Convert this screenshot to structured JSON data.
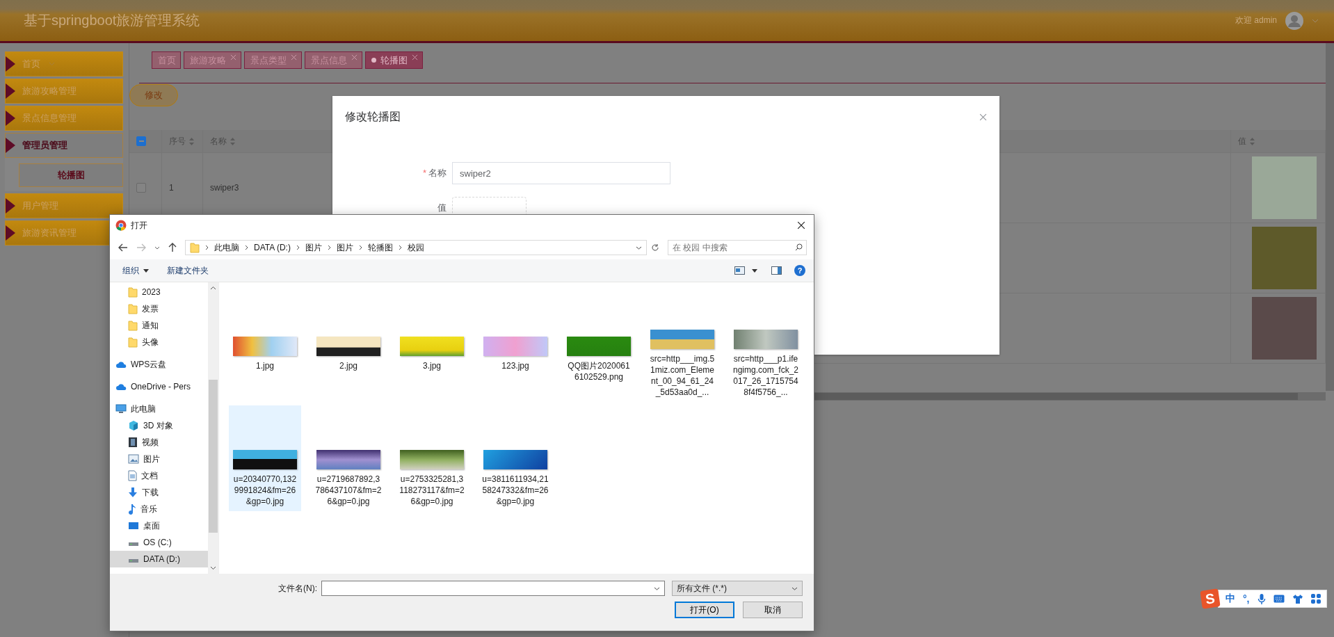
{
  "header": {
    "title": "基于springboot旅游管理系统",
    "greeting": "欢迎 admin"
  },
  "sidebar": {
    "items": [
      {
        "label": "首页",
        "kind": "dropdown",
        "expanded": false
      },
      {
        "label": "旅游攻略管理",
        "kind": "menu",
        "expanded": false
      },
      {
        "label": "景点信息管理",
        "kind": "menu",
        "expanded": false
      },
      {
        "label": "管理员管理",
        "kind": "menu",
        "expanded": true,
        "children": [
          {
            "label": "轮播图",
            "selected": true
          }
        ]
      },
      {
        "label": "用户管理",
        "kind": "menu",
        "expanded": false
      },
      {
        "label": "旅游资讯管理",
        "kind": "menu",
        "expanded": false
      }
    ]
  },
  "tabs": [
    {
      "label": "首页",
      "closable": false,
      "selected": false
    },
    {
      "label": "旅游攻略",
      "closable": true,
      "selected": false
    },
    {
      "label": "景点类型",
      "closable": true,
      "selected": false
    },
    {
      "label": "景点信息",
      "closable": true,
      "selected": false
    },
    {
      "label": "轮播图",
      "closable": true,
      "selected": true
    }
  ],
  "toolbar": {
    "edit_button": "修改"
  },
  "table": {
    "select_all": {
      "partial": true
    },
    "columns": [
      {
        "label": "序号"
      },
      {
        "label": "名称"
      },
      {
        "label": "值"
      }
    ],
    "rows": [
      {
        "checked": false,
        "index": "1",
        "name": "swiper3"
      },
      {},
      {}
    ]
  },
  "modal": {
    "title": "修改轮播图",
    "fields": [
      {
        "kind": "text",
        "mark": "*",
        "label": "名称",
        "value": "swiper2"
      },
      {
        "kind": "upload",
        "label": "值"
      }
    ]
  },
  "file_dialog": {
    "title": "打开",
    "path": [
      "此电脑",
      "DATA (D:)",
      "图片",
      "图片",
      "轮播图",
      "校园"
    ],
    "search_placeholder": "在 校园 中搜索",
    "organize": "组织",
    "new_folder": "新建文件夹",
    "help": "?",
    "nav": [
      {
        "label": "2023",
        "kind": "folder",
        "selected": false
      },
      {
        "label": "发票",
        "kind": "folder",
        "selected": false
      },
      {
        "label": "通知",
        "kind": "folder",
        "selected": false
      },
      {
        "label": "头像",
        "kind": "folder",
        "selected": false
      },
      {
        "label": "WPS云盘",
        "kind": "cloud",
        "selected": false
      },
      {
        "label": "OneDrive - Pers",
        "kind": "cloud",
        "selected": false
      },
      {
        "label": "此电脑",
        "kind": "pc",
        "selected": false,
        "children": [
          {
            "label": "3D 对象",
            "kind": "cube",
            "selected": false
          },
          {
            "label": "视频",
            "kind": "film",
            "selected": false
          },
          {
            "label": "图片",
            "kind": "picture",
            "selected": false
          },
          {
            "label": "文档",
            "kind": "document",
            "selected": false
          },
          {
            "label": "下载",
            "kind": "download",
            "selected": false
          },
          {
            "label": "音乐",
            "kind": "music",
            "selected": false
          },
          {
            "label": "桌面",
            "kind": "desktop",
            "selected": false
          },
          {
            "label": "OS (C:)",
            "kind": "drive",
            "selected": false
          },
          {
            "label": "DATA (D:)",
            "kind": "drive",
            "selected": true
          }
        ]
      }
    ],
    "files": [
      {
        "name": "1.jpg",
        "selected": false
      },
      {
        "name": "2.jpg",
        "selected": false
      },
      {
        "name": "3.jpg",
        "selected": false
      },
      {
        "name": "123.jpg",
        "selected": false
      },
      {
        "name": "QQ图片20200616102529.png",
        "selected": false
      },
      {
        "name": "src=http___img.51miz.com_Element_00_94_61_24_5d53aa0d_...",
        "selected": false
      },
      {
        "name": "src=http___p1.ifengimg.com_fck_2017_26_17157548f4f5756_...",
        "selected": false
      },
      {
        "name": "u=20340770,1329991824&fm=26&gp=0.jpg",
        "selected": true
      },
      {
        "name": "u=2719687892,3786437107&fm=26&gp=0.jpg",
        "selected": false
      },
      {
        "name": "u=2753325281,3118273117&fm=26&gp=0.jpg",
        "selected": false
      },
      {
        "name": "u=3811611934,2158247332&fm=26&gp=0.jpg",
        "selected": false
      }
    ],
    "filename_label": "文件名(N):",
    "filter": "所有文件 (*.*)",
    "open_button": "打开(O)",
    "cancel_button": "取消"
  },
  "ime": {
    "logo": "S",
    "mode": "中",
    "punctuation": "°,"
  }
}
